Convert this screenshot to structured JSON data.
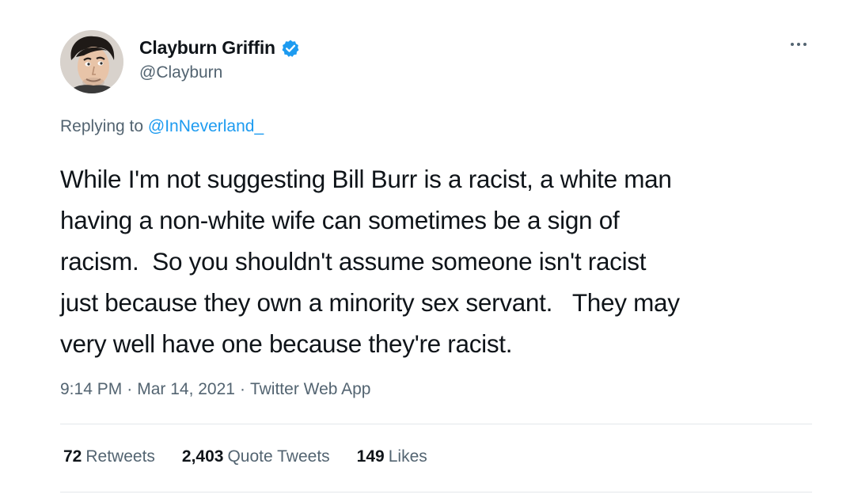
{
  "author": {
    "display_name": "Clayburn Griffin",
    "handle": "@Clayburn",
    "verified_icon": "verified-badge-icon",
    "avatar": "profile-photo"
  },
  "reply": {
    "prefix": "Replying to",
    "to_handle": "@InNeverland_"
  },
  "tweet": {
    "lines": [
      "While I'm not suggesting Bill Burr is a racist, a white man",
      "having a non-white wife can sometimes be a sign of",
      "racism.  So you shouldn't assume someone isn't racist",
      "just because they own a minority sex servant.   They may",
      "very well have one because they're racist."
    ]
  },
  "meta": {
    "time": "9:14 PM",
    "sep1": "·",
    "date": "Mar 14, 2021",
    "sep2": "·",
    "source": "Twitter Web App"
  },
  "stats": {
    "retweets_count": "72",
    "retweets_label": "Retweets",
    "quotes_count": "2,403",
    "quotes_label": "Quote Tweets",
    "likes_count": "149",
    "likes_label": "Likes"
  },
  "colors": {
    "accent": "#1d9bf0",
    "text_primary": "#0f1419",
    "text_secondary": "#536471",
    "divider": "#e3e7ea"
  }
}
